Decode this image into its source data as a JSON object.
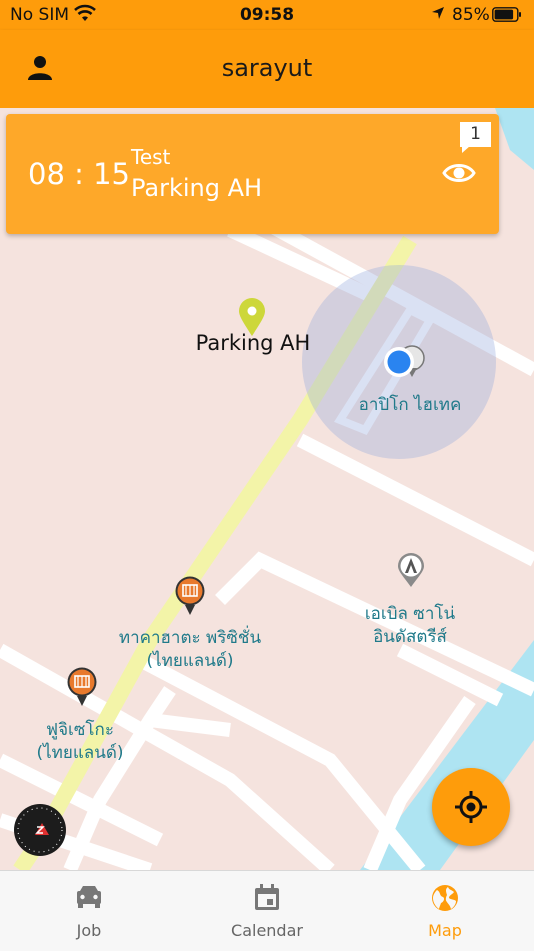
{
  "status_bar": {
    "carrier": "No SIM",
    "time": "09:58",
    "battery": "85%"
  },
  "header": {
    "title": "sarayut"
  },
  "job_card": {
    "time": "08 : 15",
    "subject": "Test",
    "place": "Parking AH",
    "badge_count": "1"
  },
  "map": {
    "parking_label": "Parking AH",
    "place_1": "อาปิโก ไฮเทค",
    "place_2a": "เอเบิล ซาโน่",
    "place_2b": "อินดัสตรีส์",
    "place_3a": "ทาคาฮาตะ พริซิชั่น",
    "place_3b": "(ไทยแลนด์)",
    "place_4a": "ฟูจิเซโกะ",
    "place_4b": "(ไทยแลนด์)"
  },
  "tabs": [
    {
      "label": "Job",
      "icon": "car-icon"
    },
    {
      "label": "Calendar",
      "icon": "calendar-icon"
    },
    {
      "label": "Map",
      "icon": "globe-icon"
    }
  ],
  "colors": {
    "accent": "#fe9c0b",
    "card": "#fea829",
    "map_bg": "#f5e3de",
    "road_main": "#f3f4a8",
    "water": "#aee4f2",
    "location": "#2a84f0"
  }
}
